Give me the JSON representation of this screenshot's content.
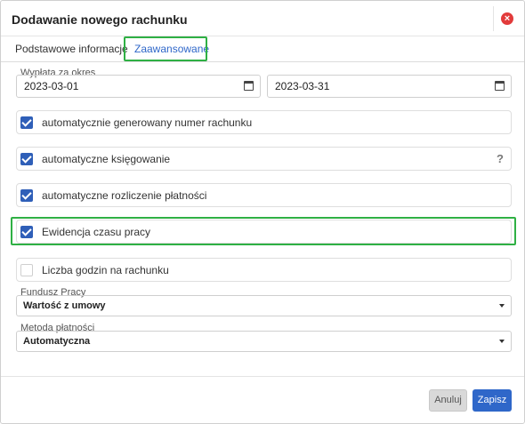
{
  "dialog": {
    "title": "Dodawanie nowego rachunku",
    "close_icon": "close-icon"
  },
  "tabs": [
    {
      "label": "Podstawowe informacje",
      "active": false
    },
    {
      "label": "Zaawansowane",
      "active": true
    }
  ],
  "period": {
    "label": "Wypłata za okres",
    "from": "2023-03-01",
    "to": "2023-03-31"
  },
  "options": [
    {
      "label": "automatycznie generowany numer rachunku",
      "checked": true
    },
    {
      "label": "automatyczne księgowanie",
      "checked": true,
      "help": "?"
    },
    {
      "label": "automatyczne rozliczenie płatności",
      "checked": true
    },
    {
      "label": "Ewidencja czasu pracy",
      "checked": true
    },
    {
      "label": "Liczba godzin na rachunku",
      "checked": false
    }
  ],
  "fund": {
    "label": "Fundusz Pracy",
    "value": "Wartość z umowy"
  },
  "payment": {
    "label": "Metoda płatności",
    "value": "Automatyczna"
  },
  "footer": {
    "cancel_label": "Anuluj",
    "save_label": "Zapisz"
  },
  "colors": {
    "accent": "#2f67c9",
    "checkbox": "#2f5fb8",
    "highlight": "#2fb044",
    "close": "#e23b3b"
  }
}
